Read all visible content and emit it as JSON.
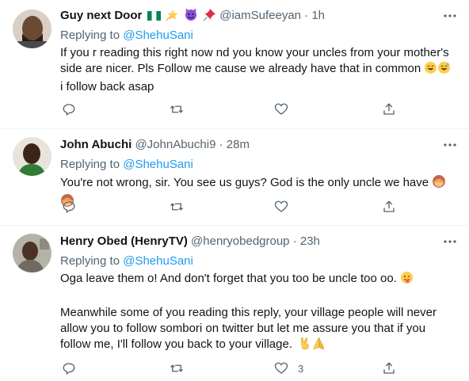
{
  "tweets": [
    {
      "name": "Guy next Door",
      "handle": "@iamSufeeyan",
      "sep": "·",
      "time": "1h",
      "replying_prefix": "Replying to",
      "replying_to": "@ShehuSani",
      "text_1": "If you r reading this right now nd you know your uncles from your mother's side are nicer. Pls Follow me cause we already have that in common",
      "text_2": "i follow back asap",
      "like_count": ""
    },
    {
      "name": "John Abuchi",
      "handle": "@JohnAbuchi9",
      "sep": "·",
      "time": "28m",
      "replying_prefix": "Replying to",
      "replying_to": "@ShehuSani",
      "text_1": "You're not wrong, sir. You see us guys? God is the only uncle we have",
      "like_count": ""
    },
    {
      "name": "Henry Obed (HenryTV)",
      "handle": "@henryobedgroup",
      "sep": "·",
      "time": "23h",
      "replying_prefix": "Replying to",
      "replying_to": "@ShehuSani",
      "text_1": "Oga leave them o! And don't forget that you too be uncle too oo.",
      "text_2": "Meanwhile some of you reading this reply, your village people will never allow you to follow sombori on twitter but let me assure you that if you follow me, I'll follow you back to your village.",
      "like_count": "3"
    }
  ],
  "icons": {
    "reply": "reply-icon",
    "retweet": "retweet-icon",
    "like": "heart-icon",
    "share": "share-icon",
    "more": "more-icon"
  },
  "colors": {
    "text": "#0f1419",
    "muted": "#536471",
    "link": "#1d9bf0",
    "divider": "#eff3f4"
  }
}
